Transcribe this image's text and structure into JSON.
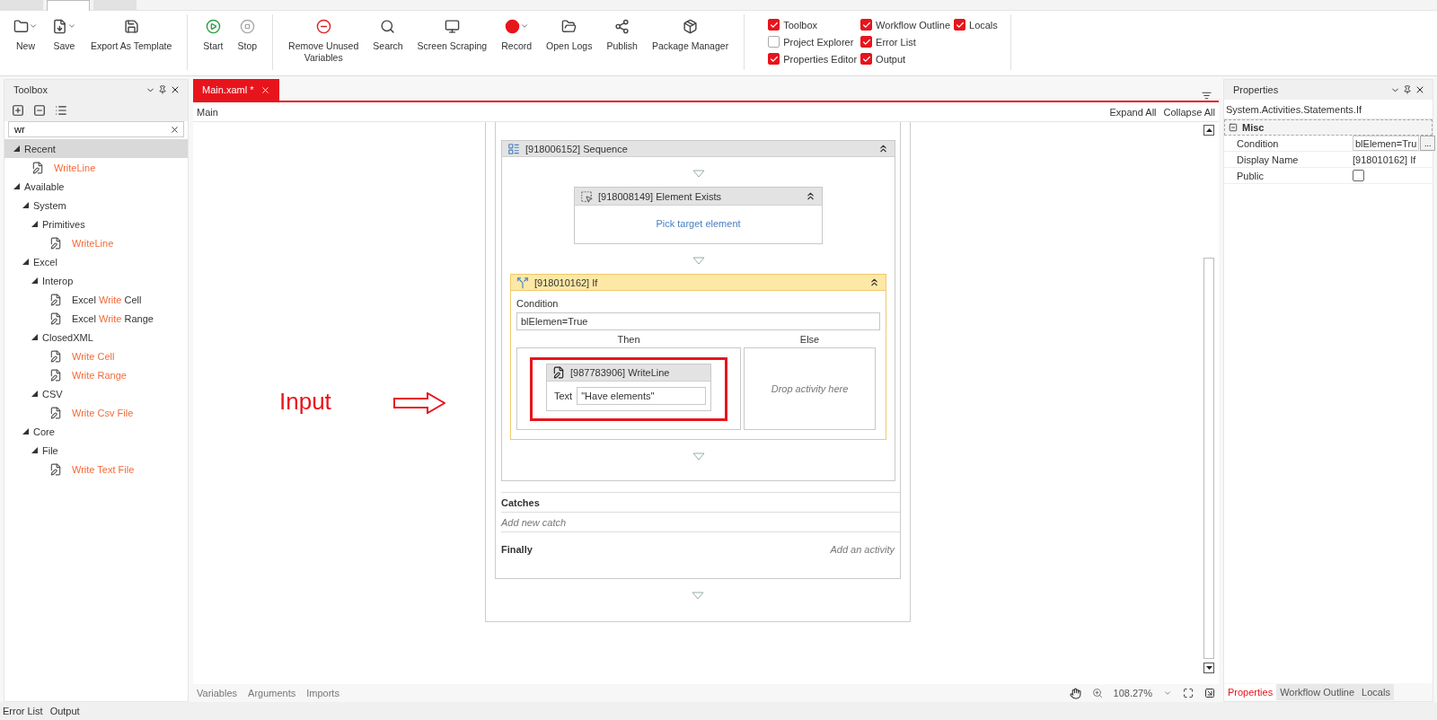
{
  "top_tabs": [
    {
      "selected": false
    },
    {
      "selected": true
    },
    {
      "selected": false
    }
  ],
  "ribbon": {
    "groups": [
      [
        {
          "label": "New",
          "dropdown": true,
          "disabled": false
        },
        {
          "label": "Save",
          "dropdown": true,
          "disabled": false
        },
        {
          "label": "Export As Template",
          "dropdown": false,
          "disabled": false
        }
      ],
      [
        {
          "label": "Start",
          "dropdown": false,
          "disabled": false
        },
        {
          "label": "Stop",
          "dropdown": false,
          "disabled": true
        }
      ],
      [
        {
          "label": "Remove Unused\nVariables",
          "dropdown": false,
          "disabled": false
        },
        {
          "label": "Search",
          "dropdown": false,
          "disabled": false
        },
        {
          "label": "Screen Scraping",
          "dropdown": false,
          "disabled": false
        },
        {
          "label": "Record",
          "dropdown": true,
          "disabled": false
        },
        {
          "label": "Open Logs",
          "dropdown": false,
          "disabled": false
        },
        {
          "label": "Publish",
          "dropdown": false,
          "disabled": false
        },
        {
          "label": "Package Manager",
          "dropdown": false,
          "disabled": false
        }
      ]
    ],
    "panels": [
      {
        "label": "Toolbox",
        "checked": true
      },
      {
        "label": "Project Explorer",
        "checked": false
      },
      {
        "label": "Properties Editor",
        "checked": true
      },
      {
        "label": "Workflow Outline",
        "checked": true
      },
      {
        "label": "Error List",
        "checked": true
      },
      {
        "label": "Output",
        "checked": true
      },
      {
        "label": "Locals",
        "checked": true
      }
    ]
  },
  "toolbox": {
    "title": "Toolbox",
    "search": {
      "value": "wr"
    },
    "tree": [
      {
        "kind": "category",
        "label": "Recent",
        "selected": true,
        "expanded": true,
        "children": [
          {
            "kind": "activity",
            "selected": false,
            "match": "WriteLine"
          }
        ]
      },
      {
        "kind": "category",
        "label": "Available",
        "selected": false,
        "expanded": true,
        "children": [
          {
            "kind": "category",
            "label": "System",
            "selected": false,
            "expanded": true,
            "children": [
              {
                "kind": "category",
                "label": "Primitives",
                "selected": false,
                "expanded": true,
                "children": [
                  {
                    "kind": "activity",
                    "selected": false,
                    "match": "WriteLine"
                  }
                ]
              }
            ]
          },
          {
            "kind": "category",
            "label": "Excel",
            "selected": false,
            "expanded": true,
            "children": [
              {
                "kind": "category",
                "label": "Interop",
                "selected": false,
                "expanded": true,
                "children": [
                  {
                    "kind": "activity",
                    "selected": false,
                    "pre": "Excel ",
                    "match": "Write",
                    "post": " Cell"
                  },
                  {
                    "kind": "activity",
                    "selected": false,
                    "pre": "Excel ",
                    "match": "Write",
                    "post": " Range"
                  }
                ]
              },
              {
                "kind": "category",
                "label": "ClosedXML",
                "selected": false,
                "expanded": true,
                "children": [
                  {
                    "kind": "activity",
                    "selected": false,
                    "match": "Write Cell"
                  },
                  {
                    "kind": "activity",
                    "selected": false,
                    "match": "Write Range"
                  }
                ]
              },
              {
                "kind": "category",
                "label": "CSV",
                "selected": false,
                "expanded": true,
                "children": [
                  {
                    "kind": "activity",
                    "selected": false,
                    "match": "Write Csv File"
                  }
                ]
              }
            ]
          },
          {
            "kind": "category",
            "label": "Core",
            "selected": false,
            "expanded": true,
            "children": [
              {
                "kind": "category",
                "label": "File",
                "selected": false,
                "expanded": true,
                "children": [
                  {
                    "kind": "activity",
                    "selected": false,
                    "match": "Write Text File"
                  }
                ]
              }
            ]
          }
        ]
      }
    ]
  },
  "designer": {
    "tab": {
      "label": "Main.xaml *",
      "selected": true
    },
    "breadcrumb": "Main",
    "expand_all": "Expand All",
    "collapse_all": "Collapse All",
    "sequence": {
      "title": "[918006152] Sequence",
      "activities": [
        {
          "kind": "element_exists",
          "selected": false,
          "title": "[918008149] Element Exists",
          "link": "Pick target element"
        },
        {
          "kind": "if",
          "selected": true,
          "title": "[918010162] If",
          "condition_label": "Condition",
          "condition": "blElemen=True",
          "then_label": "Then",
          "else_label": "Else",
          "then": {
            "title": "[987783906] WriteLine",
            "field_label": "Text",
            "value": "\"Have elements\"",
            "highlighted": true
          },
          "else_hint": "Drop activity here"
        }
      ]
    },
    "catches_label": "Catches",
    "add_catch": "Add new catch",
    "finally_label": "Finally",
    "add_activity": "Add an activity",
    "annotation": {
      "label": "Input"
    },
    "bottom_tabs": [
      "Variables",
      "Arguments",
      "Imports"
    ],
    "zoom": "108.27%"
  },
  "properties": {
    "title": "Properties",
    "type": "System.Activities.Statements.If",
    "category": "Misc",
    "expanded": true,
    "rows": [
      {
        "kind": "expression",
        "name": "Condition",
        "value": "blElemen=Tru",
        "button": "..."
      },
      {
        "kind": "text",
        "name": "Display Name",
        "value": "[918010162] If"
      },
      {
        "kind": "checkbox",
        "name": "Public",
        "checked": false
      }
    ],
    "tabs": [
      {
        "label": "Properties",
        "selected": true
      },
      {
        "label": "Workflow Outline",
        "selected": false
      },
      {
        "label": "Locals",
        "selected": false
      }
    ]
  },
  "status_bar": [
    "Error List",
    "Output"
  ]
}
